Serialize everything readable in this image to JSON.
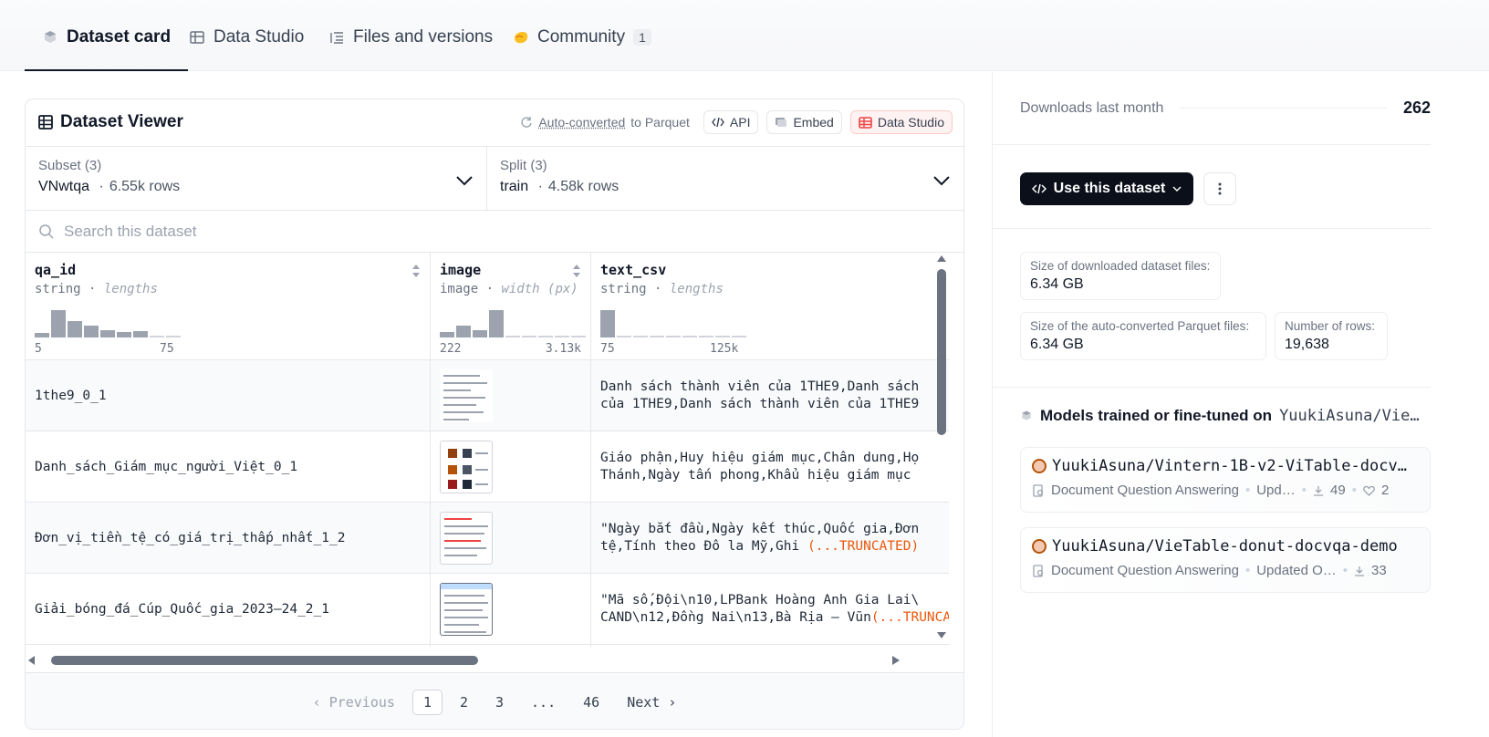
{
  "tabs": [
    {
      "label": "Dataset card",
      "active": true
    },
    {
      "label": "Data Studio"
    },
    {
      "label": "Files and versions"
    },
    {
      "label": "Community",
      "badge": "1"
    }
  ],
  "viewer": {
    "title": "Dataset Viewer",
    "autoconv_a": "Auto-converted",
    "autoconv_b": " to Parquet",
    "api": "API",
    "embed": "Embed",
    "studio": "Data Studio",
    "subset": {
      "label": "Subset (3)",
      "value": "VNwtqa",
      "rows": "6.55k rows"
    },
    "split": {
      "label": "Split (3)",
      "value": "train",
      "rows": "4.58k rows"
    },
    "search_placeholder": "Search this dataset",
    "columns": [
      {
        "name": "qa_id",
        "type": "string",
        "stat": "lengths",
        "min": "5",
        "max": "75",
        "hist": [
          0.15,
          0.95,
          0.55,
          0.42,
          0.25,
          0.2,
          0.22,
          0.04,
          0.04
        ]
      },
      {
        "name": "image",
        "type": "image",
        "stat": "width (px)",
        "min": "222",
        "max": "3.13k",
        "hist": [
          0.18,
          0.42,
          0.25,
          0.95,
          0.04,
          0.04,
          0.04,
          0.04,
          0.04
        ]
      },
      {
        "name": "text_csv",
        "type": "string",
        "stat": "lengths",
        "min": "75",
        "max": "125k",
        "hist": [
          0.95,
          0.04,
          0.04,
          0.04,
          0.04,
          0.04,
          0.04,
          0.04,
          0.04
        ]
      }
    ],
    "rows": [
      {
        "qa_id": "1the9_0_1",
        "text_1": "Danh sách thành viên của 1THE9,Danh sách",
        "text_2": "của 1THE9,Danh sách thành viên của 1THE9",
        "trunc": ""
      },
      {
        "qa_id": "Danh_sách_Giám_mục_người_Việt_0_1",
        "text_1": "Giáo phận,Huy hiệu giám mục,Chân dung,Họ",
        "text_2": "Thánh,Ngày tấn phong,Khẩu hiệu giám mục",
        "trunc": ""
      },
      {
        "qa_id": "Đơn_vị_tiền_tệ_có_giá_trị_thấp_nhất_1_2",
        "text_1": "\"Ngày bắt đầu,Ngày kết thúc,Quốc gia,Đơn",
        "text_2": "tệ,Tính theo Đô la Mỹ,Ghi ",
        "trunc": "(...TRUNCATED)"
      },
      {
        "qa_id": "Giải_bóng_đá_Cúp_Quốc_gia_2023–24_2_1",
        "text_1": "\"Mã số,Đội\\n10,LPBank Hoàng Anh Gia Lai\\",
        "text_2": "CAND\\n12,Đồng Nai\\n13,Bà Rịa – Vũn",
        "trunc": "(...TRUNCATED)"
      }
    ],
    "pager": {
      "prev": "Previous",
      "pages": [
        "1",
        "2",
        "3",
        "...",
        "46"
      ],
      "next": "Next"
    }
  },
  "sidebar": {
    "downloads_label": "Downloads last month",
    "downloads": "262",
    "use_button": "Use this dataset",
    "stats": [
      {
        "k": "Size of downloaded dataset files:",
        "v": "6.34 GB"
      },
      {
        "k": "Size of the auto-converted Parquet files:",
        "v": "6.34 GB"
      },
      {
        "k": "Number of rows:",
        "v": "19,638"
      }
    ],
    "models_heading": "Models trained or fine-tuned on",
    "models_repo": "YuukiAsuna/Vie…",
    "models": [
      {
        "name": "YuukiAsuna/Vintern-1B-v2-ViTable-docv…",
        "task": "Document Question Answering",
        "updated": "Upd…",
        "downloads": "49",
        "likes": "2"
      },
      {
        "name": "YuukiAsuna/VieTable-donut-docvqa-demo",
        "task": "Document Question Answering",
        "updated": "Updated O…",
        "downloads": "33"
      }
    ]
  }
}
